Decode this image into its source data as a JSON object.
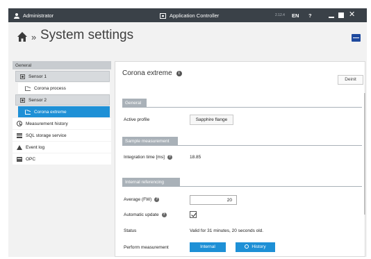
{
  "titlebar": {
    "user": "Administrator",
    "app_title": "Application Controller",
    "version": "2.12.4",
    "language": "EN",
    "help": "?",
    "close_glyph": "✕"
  },
  "header": {
    "breadcrumb_sep": "»",
    "page_title": "System settings"
  },
  "sidebar": {
    "section_label": "General",
    "items": [
      {
        "label": "Sensor 1",
        "icon": "sensor-icon"
      },
      {
        "label": "Corona process",
        "icon": "chart-icon"
      },
      {
        "label": "Sensor 2",
        "icon": "sensor-icon"
      },
      {
        "label": "Corona extreme",
        "icon": "chart-icon",
        "selected": true
      },
      {
        "label": "Measurement history",
        "icon": "history-icon"
      },
      {
        "label": "SQL storage service",
        "icon": "database-icon"
      },
      {
        "label": "Event log",
        "icon": "warning-icon"
      },
      {
        "label": "OPC",
        "icon": "opc-icon"
      }
    ]
  },
  "main": {
    "title": "Corona extreme",
    "info_glyph": "i",
    "help_glyph": "?",
    "deinit_label": "Deinit",
    "sections": {
      "general": "General",
      "sample": "Sample measurement",
      "internal": "Internal referencing"
    },
    "active_profile_label": "Active profile",
    "active_profile_value": "Sapphire flange",
    "integration_label": "Integration time [ms]",
    "integration_value": "18.85",
    "average_label": "Average (FW)",
    "average_value": "20",
    "auto_update_label": "Automatic update",
    "auto_update_checked": true,
    "status_label": "Status",
    "status_value": "Valid for 31 minutes, 20 seconds old.",
    "perform_label": "Perform measurement",
    "internal_button": "Internal",
    "history_button": "History"
  },
  "colors": {
    "accent": "#1e90d6",
    "titlebar": "#3a4148",
    "section_header": "#a9b1b8",
    "brand": "#1f4a9e"
  }
}
